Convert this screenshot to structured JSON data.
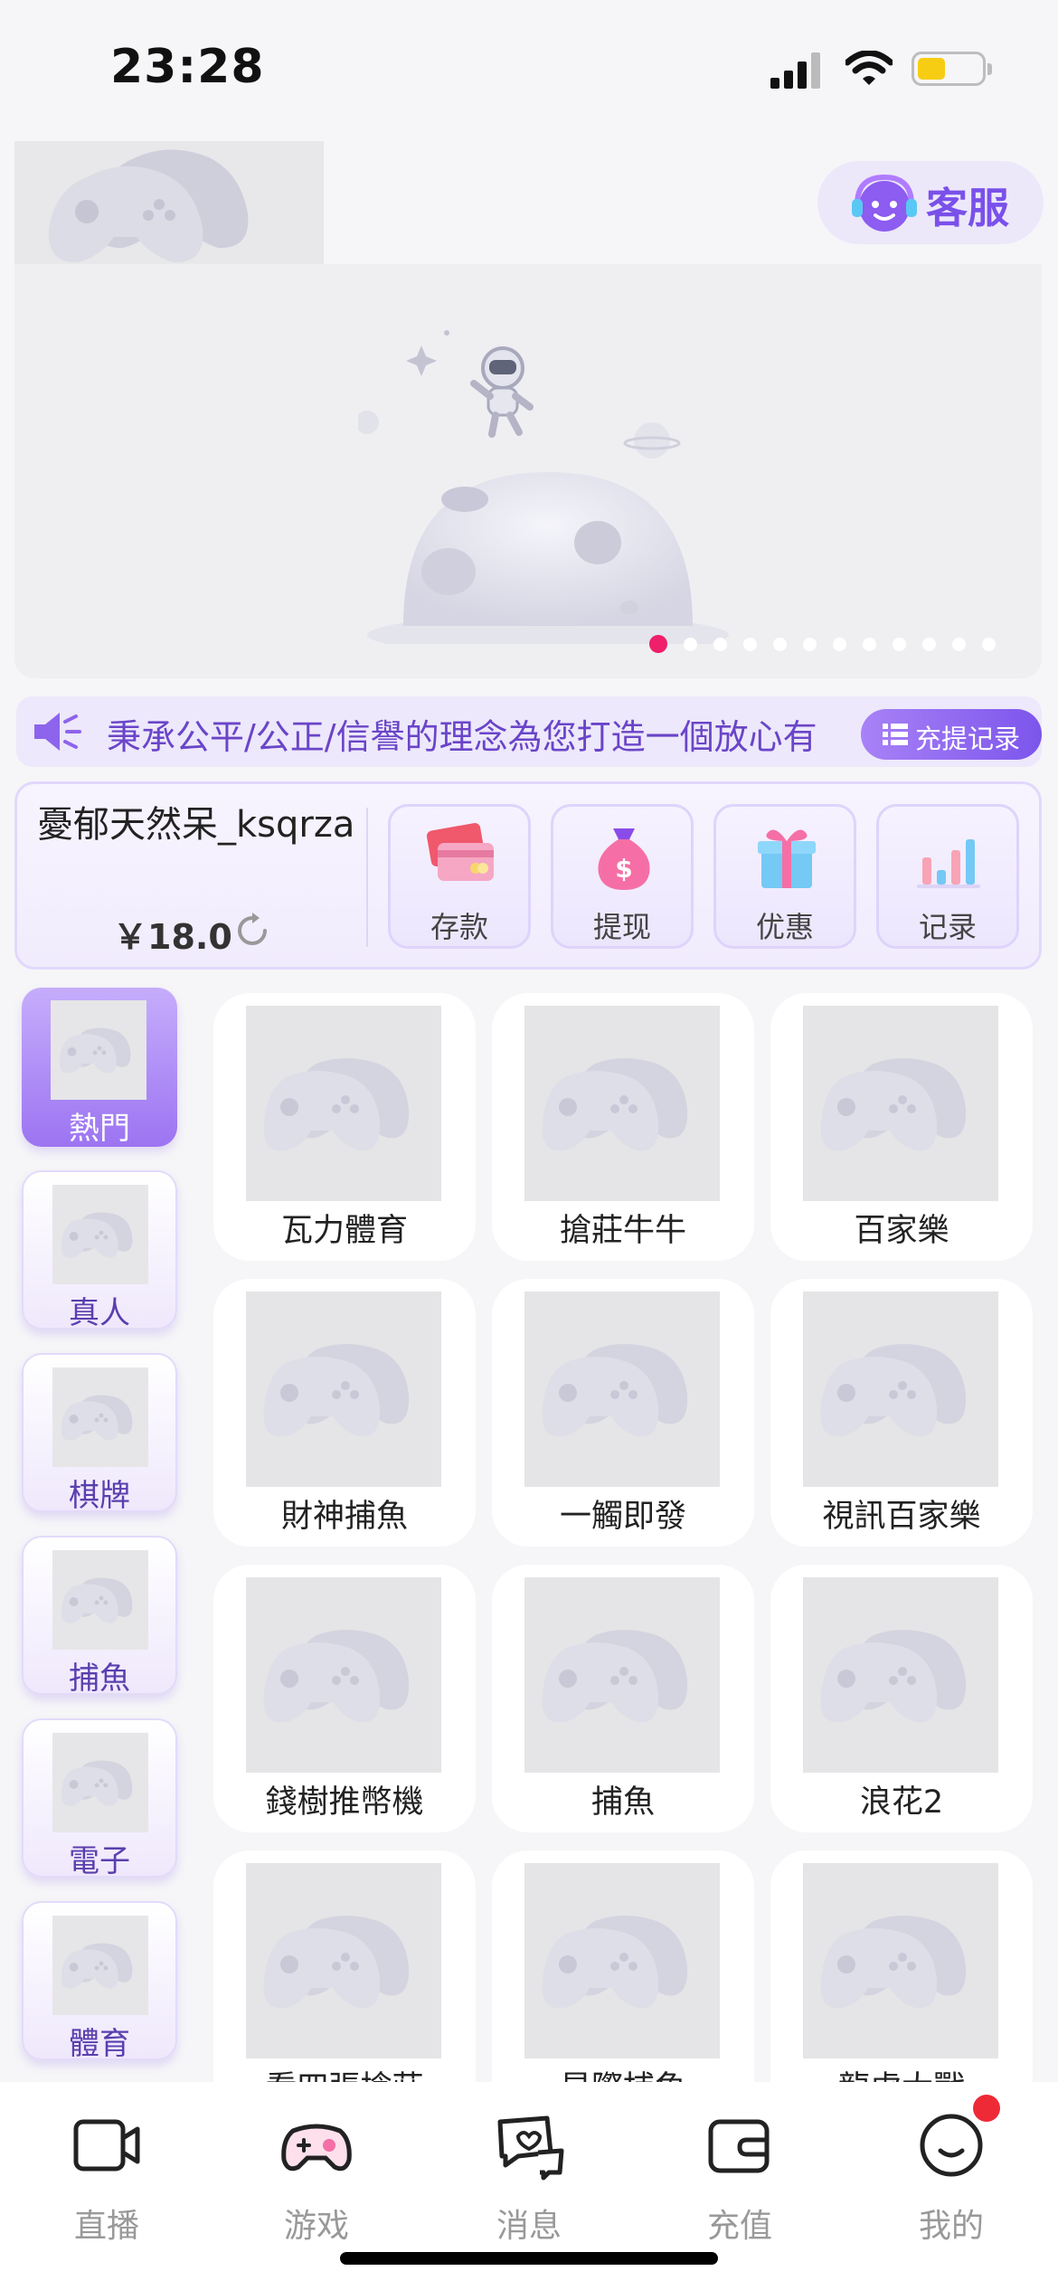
{
  "status_bar": {
    "time": "23:28"
  },
  "header": {
    "service_label": "客服"
  },
  "banner": {
    "slide_count": 12,
    "active_index": 0
  },
  "marquee": {
    "text": "秉承公平/公正/信譽的理念為您打造一個放心有",
    "record_label": "充提记录"
  },
  "user": {
    "name": "憂郁天然呆_ksqrza",
    "balance": "￥18.0"
  },
  "actions": [
    {
      "label": "存款",
      "icon": "wallet-cards-icon"
    },
    {
      "label": "提现",
      "icon": "money-bag-icon"
    },
    {
      "label": "优惠",
      "icon": "gift-icon"
    },
    {
      "label": "记录",
      "icon": "bar-chart-icon"
    }
  ],
  "categories": [
    {
      "label": "熱門",
      "active": true
    },
    {
      "label": "真人",
      "active": false
    },
    {
      "label": "棋牌",
      "active": false
    },
    {
      "label": "捕魚",
      "active": false
    },
    {
      "label": "電子",
      "active": false
    },
    {
      "label": "體育",
      "active": false
    }
  ],
  "games": [
    {
      "name": "瓦力體育"
    },
    {
      "name": "搶莊牛牛"
    },
    {
      "name": "百家樂"
    },
    {
      "name": "財神捕魚"
    },
    {
      "name": "一觸即發"
    },
    {
      "name": "視訊百家樂"
    },
    {
      "name": "錢樹推幣機"
    },
    {
      "name": "捕魚"
    },
    {
      "name": "浪花2"
    },
    {
      "name": "看四張搶莊"
    },
    {
      "name": "星際捕魚"
    },
    {
      "name": "龍虎大戰"
    }
  ],
  "tabbar": [
    {
      "label": "直播",
      "icon": "camera-icon"
    },
    {
      "label": "游戏",
      "icon": "gamepad-icon"
    },
    {
      "label": "消息",
      "icon": "message-icon"
    },
    {
      "label": "充值",
      "icon": "wallet-icon"
    },
    {
      "label": "我的",
      "icon": "profile-icon"
    }
  ],
  "colors": {
    "accent": "#7c55ec",
    "active_dot": "#ef1f6a",
    "badge": "#ee2a36"
  }
}
